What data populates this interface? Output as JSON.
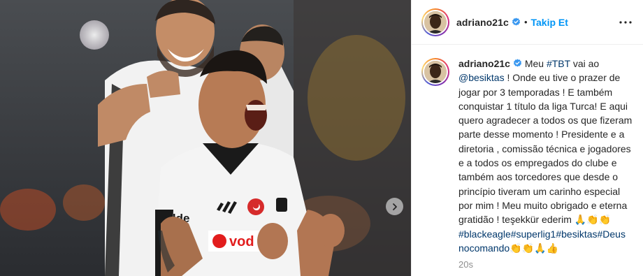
{
  "post": {
    "author": {
      "username": "adriano21c",
      "verified": true,
      "follow_label": "Takip Et",
      "separator": "•"
    },
    "more_icon": "ellipsis-icon",
    "media": {
      "jersey_sponsor": "vod",
      "jersey_brand": "kalde"
    },
    "caption": {
      "username": "adriano21c",
      "segments": [
        {
          "type": "text",
          "value": "Meu "
        },
        {
          "type": "tag",
          "value": "#TBT"
        },
        {
          "type": "text",
          "value": " vai ao "
        },
        {
          "type": "tag",
          "value": "@besiktas"
        },
        {
          "type": "text",
          "value": " ! Onde eu tive o prazer de jogar por 3 temporadas ! E também conquistar 1 título da liga Turca! E aqui quero agradecer a todos os que fizeram parte desse momento ! Presidente e a diretoria , comissão técnica e jogadores e a todos os empregados do clube e também aos torcedores que desde o princípio tiveram um carinho especial por mim ! Meu muito obrigado e eterna gratidão ! teşekkür ederim 🙏👏👏 "
        },
        {
          "type": "tag",
          "value": "#blackeagle"
        },
        {
          "type": "tag",
          "value": "#superlig1"
        },
        {
          "type": "tag",
          "value": "#besiktas"
        },
        {
          "type": "tag",
          "value": "#Deus nocomando"
        },
        {
          "type": "text",
          "value": "👏👏🙏👍"
        }
      ]
    },
    "timestamp": "20s",
    "colors": {
      "follow": "#0095f6",
      "hashtag": "#00376b",
      "meta": "#8e8e8e"
    }
  }
}
